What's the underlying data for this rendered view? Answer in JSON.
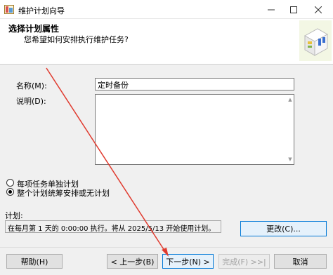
{
  "window": {
    "title": "维护计划向导"
  },
  "header": {
    "title": "选择计划属性",
    "subtitle": "您希望如何安排执行维护任务?"
  },
  "form": {
    "name_label": "名称(M):",
    "name_value": "定时备份",
    "desc_label": "说明(D):",
    "desc_value": ""
  },
  "options": {
    "items": [
      {
        "label": "每项任务单独计划",
        "checked": false
      },
      {
        "label": "整个计划统筹安排或无计划",
        "checked": true
      }
    ]
  },
  "schedule": {
    "label": "计划:",
    "text": "在每月第 1 天的 0:00:00 执行。将从 2025/5/13 开始使用计划。",
    "change_button": "更改(C)..."
  },
  "footer": {
    "help_button": "帮助(H)",
    "back_button": "< 上一步(B)",
    "next_button": "下一步(N) >",
    "finish_button": "完成(F) >>|",
    "cancel_button": "取消"
  },
  "colors": {
    "accent": "#0078d7",
    "annotation_arrow": "#e03a2e"
  }
}
